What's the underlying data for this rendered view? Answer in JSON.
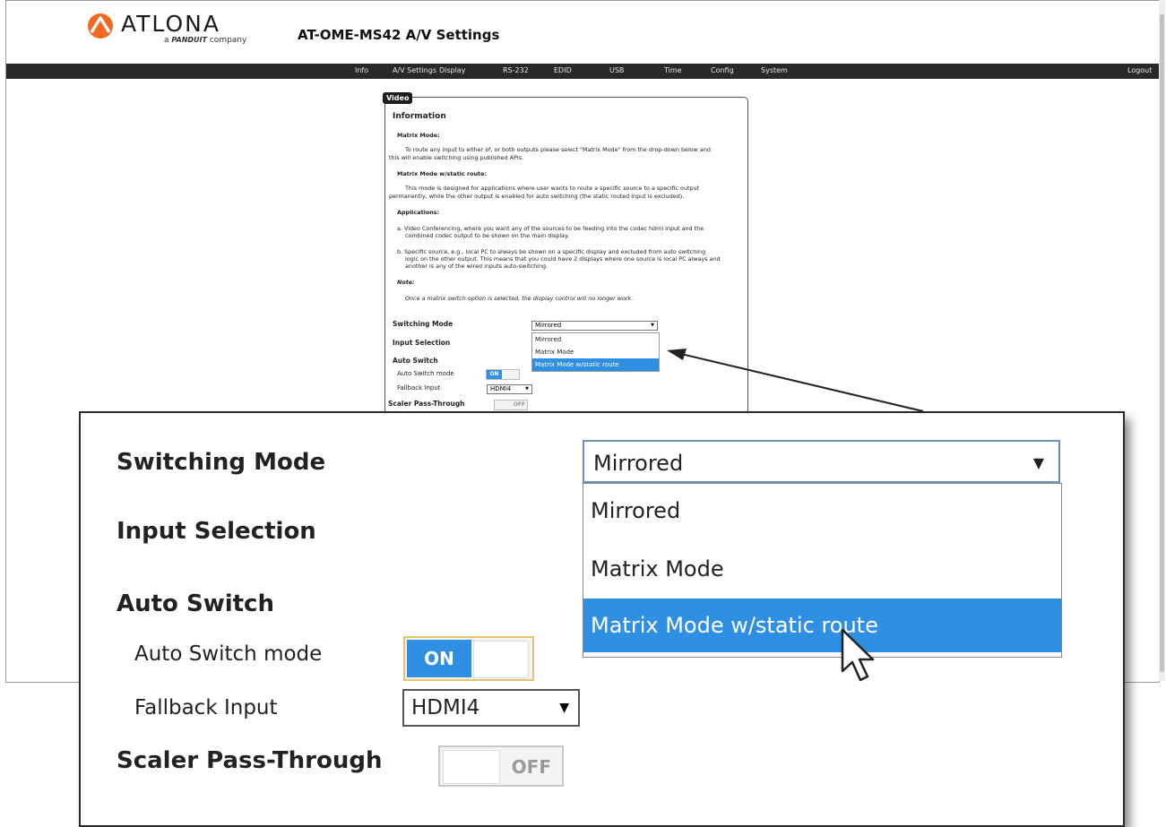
{
  "brand": {
    "name": "ATLONA",
    "tagline_prefix": "a",
    "tagline_brand": "PANDUIT",
    "tagline_suffix": "company",
    "logo_color": "#f26a21"
  },
  "page_title": "AT-OME-MS42  A/V Settings",
  "nav": {
    "items": [
      "Info",
      "A/V Settings",
      "Display",
      "RS-232",
      "EDID",
      "USB",
      "Time",
      "Config",
      "System"
    ],
    "logout": "Logout"
  },
  "panel": {
    "tab": "Video",
    "information": "Information",
    "matrix_mode_heading": "Matrix Mode:",
    "matrix_mode_text_1": "To route any input to either of, or both outputs please select \"Matrix Mode\" from the drop-down below and",
    "matrix_mode_text_2": "this will enable switching using published APIs.",
    "static_heading": "Matrix Mode w/static route:",
    "static_text_1": "This mode is designed for applications where user wants to route a specific source to a specific output",
    "static_text_2": "permanently, while the other output is enabled for auto switching (the static routed input is excluded).",
    "applications_heading": "Applications:",
    "app_a_1": "a.  Video Conferencing, where you want any of the sources to be feeding into the codec hdmi input and the",
    "app_a_2": "combined codec output to be shown on the main display.",
    "app_b_1": "b.  Specific source, e.g., local PC to always be shown on a specific display and excluded from auto switching",
    "app_b_2": "logic on the other output. This means that you could have 2 displays where one source is local PC always and",
    "app_b_3": "another is any of the wired inputs auto-switching.",
    "note_heading": "Note:",
    "note_text": "Once a matrix switch option is selected, the display control will no longer work."
  },
  "form": {
    "switching_mode_label": "Switching Mode",
    "switching_mode_value": "Mirrored",
    "switching_mode_options": [
      "Mirrored",
      "Matrix Mode",
      "Matrix Mode w/static route"
    ],
    "input_selection_label": "Input Selection",
    "auto_switch_label": "Auto Switch",
    "auto_switch_mode_label": "Auto Switch mode",
    "auto_switch_state": "ON",
    "fallback_input_label": "Fallback Input",
    "fallback_input_value": "HDMI4",
    "scaler_label": "Scaler Pass-Through",
    "scaler_state": "OFF"
  },
  "colors": {
    "highlight": "#2f8fe3",
    "navbar": "#292929"
  }
}
